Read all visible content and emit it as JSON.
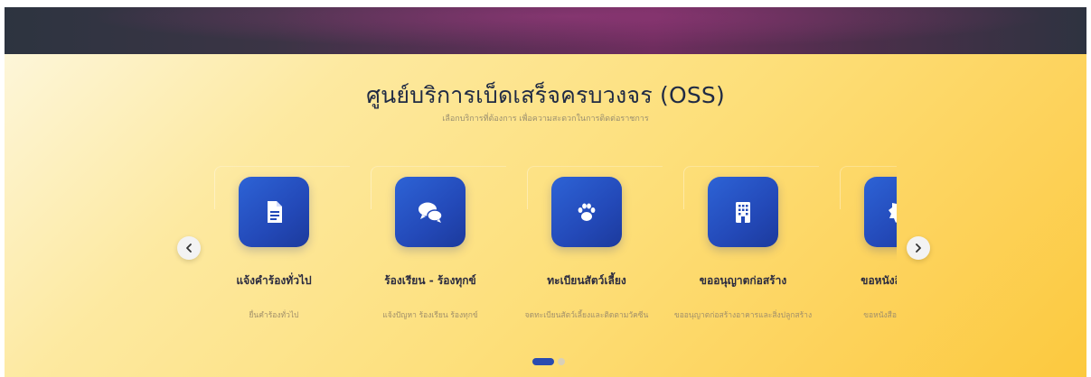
{
  "section": {
    "title": "ศูนย์บริการเบ็ดเสร็จครบวงจร (OSS)",
    "subtitle": "เลือกบริการที่ต้องการ เพื่อความสะดวกในการติดต่อราชการ"
  },
  "services": [
    {
      "icon": "document-icon",
      "title": "แจ้งคำร้องทั่วไป",
      "desc": "ยื่นคำร้องทั่วไป"
    },
    {
      "icon": "chat-icon",
      "title": "ร้องเรียน - ร้องทุกข์",
      "desc": "แจ้งปัญหา ร้องเรียน ร้องทุกข์"
    },
    {
      "icon": "paw-icon",
      "title": "ทะเบียนสัตว์เลี้ยง",
      "desc": "จดทะเบียนสัตว์เลี้ยงและติดตามวัคซีน"
    },
    {
      "icon": "building-icon",
      "title": "ขออนุญาตก่อสร้าง",
      "desc": "ขออนุญาตก่อสร้างอาคารและสิ่งปลูกสร้าง"
    },
    {
      "icon": "certificate-icon",
      "title": "ขอหนังสือรับรอง",
      "desc": "ขอหนังสือรับรองต่างๆ"
    }
  ],
  "carousel": {
    "prev_icon": "chevron-left-icon",
    "next_icon": "chevron-right-icon",
    "page_count": 2,
    "active_page": 1
  },
  "colors": {
    "accent": "#2349b8",
    "title": "#1f2a44",
    "background_yellow": "#fdd25a"
  }
}
